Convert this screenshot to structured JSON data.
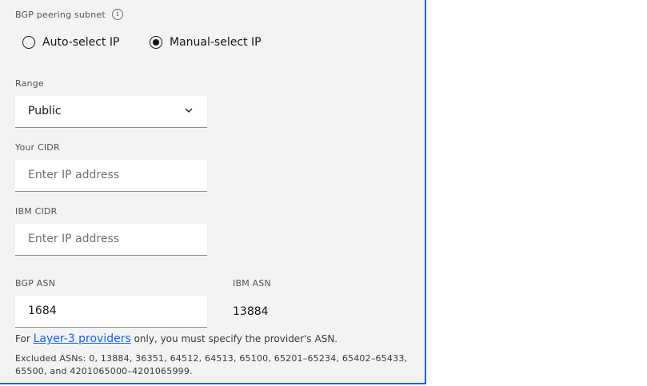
{
  "bgp_subnet": {
    "label": "BGP peering subnet",
    "info_icon": "i",
    "options": [
      {
        "label": "Auto-select IP",
        "checked": false
      },
      {
        "label": "Manual-select IP",
        "checked": true
      }
    ]
  },
  "range": {
    "label": "Range",
    "value": "Public"
  },
  "your_cidr": {
    "label": "Your CIDR",
    "placeholder": "Enter IP address"
  },
  "ibm_cidr": {
    "label": "IBM CIDR",
    "placeholder": "Enter IP address"
  },
  "bgp_asn": {
    "label": "BGP ASN",
    "value": "1684"
  },
  "ibm_asn": {
    "label": "IBM ASN",
    "value": "13884"
  },
  "helper": {
    "prefix": "For ",
    "link": "Layer-3 providers",
    "suffix": " only, you must specify the provider's ASN."
  },
  "excluded": "Excluded ASNs: 0, 13884, 36351, 64512, 64513, 65100, 65201–65234, 65402–65433, 65500, and 4201065000–4201065999."
}
